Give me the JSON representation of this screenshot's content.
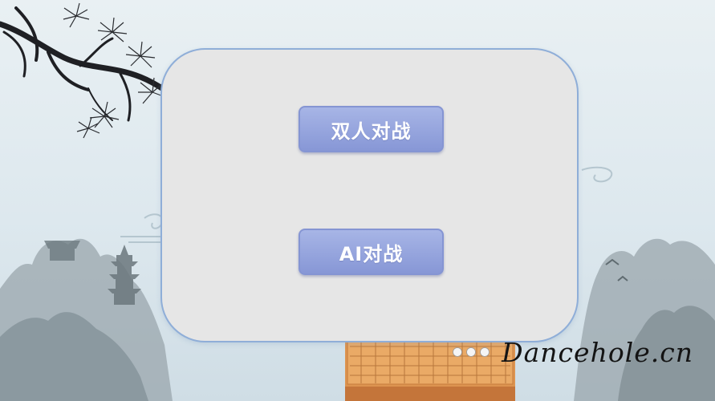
{
  "menu": {
    "pvp_label": "双人对战",
    "ai_label": "AI对战"
  },
  "watermark": "Dancehole.cn",
  "decorations": [
    "pine-branch",
    "misty-mountains",
    "pagoda",
    "go-board"
  ],
  "colors": {
    "button_fill": "#95a4dd",
    "button_border": "#8595d3",
    "panel_fill": "#e6e6e6",
    "panel_border": "#8faed8",
    "board_wood": "#e8a560"
  }
}
